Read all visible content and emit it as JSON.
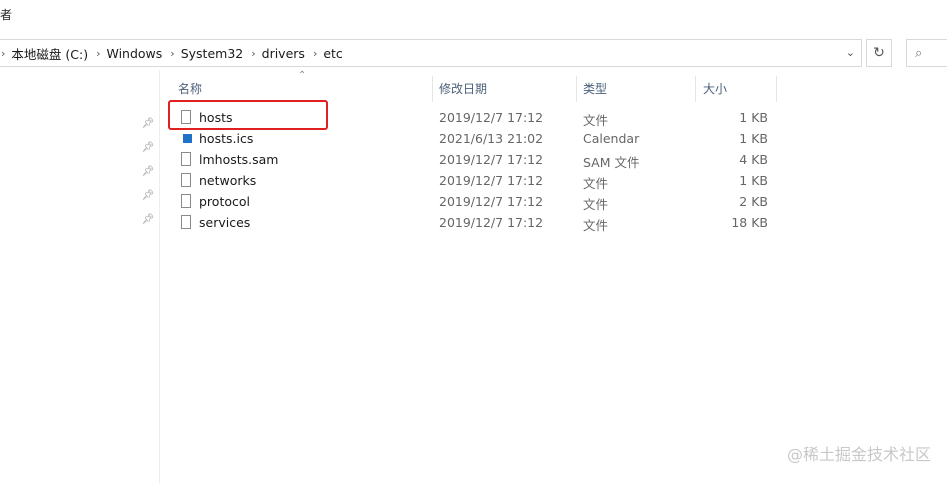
{
  "window": {
    "title_fragment": "者"
  },
  "address": {
    "crumbs": [
      "本地磁盘 (C:)",
      "Windows",
      "System32",
      "drivers",
      "etc"
    ]
  },
  "search": {
    "icon": "search-icon"
  },
  "columns": {
    "name": "名称",
    "modified": "修改日期",
    "type": "类型",
    "size": "大小"
  },
  "files": [
    {
      "name": "hosts",
      "modified": "2019/12/7 17:12",
      "type": "文件",
      "size": "1 KB",
      "icon": "file-icon"
    },
    {
      "name": "hosts.ics",
      "modified": "2021/6/13 21:02",
      "type": "Calendar",
      "size": "1 KB",
      "icon": "calendar-file-icon"
    },
    {
      "name": "lmhosts.sam",
      "modified": "2019/12/7 17:12",
      "type": "SAM 文件",
      "size": "4 KB",
      "icon": "file-icon"
    },
    {
      "name": "networks",
      "modified": "2019/12/7 17:12",
      "type": "文件",
      "size": "1 KB",
      "icon": "file-icon"
    },
    {
      "name": "protocol",
      "modified": "2019/12/7 17:12",
      "type": "文件",
      "size": "2 KB",
      "icon": "file-icon"
    },
    {
      "name": "services",
      "modified": "2019/12/7 17:12",
      "type": "文件",
      "size": "18 KB",
      "icon": "file-icon"
    }
  ],
  "watermark": "@稀土掘金技术社区",
  "colors": {
    "highlight": "#e02020",
    "header_text": "#4c607a"
  }
}
